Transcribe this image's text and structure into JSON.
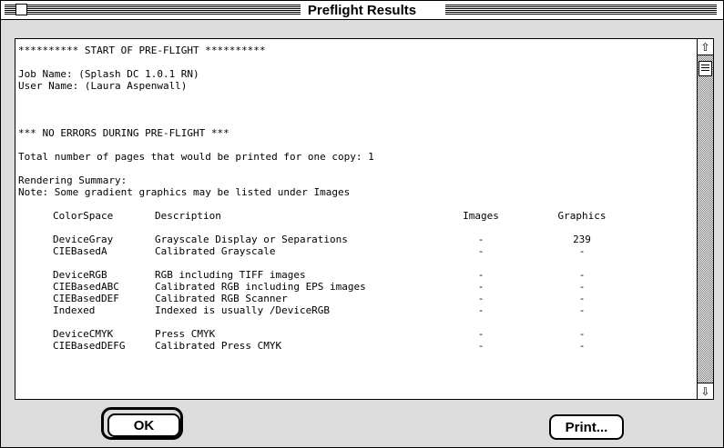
{
  "window": {
    "title": "Preflight Results"
  },
  "report": {
    "header": "********** START OF PRE-FLIGHT **********",
    "job_name": "Job Name: (Splash DC 1.0.1 RN)",
    "user_name": "User Name: (Laura Aspenwall)",
    "status": "*** NO ERRORS DURING PRE-FLIGHT ***",
    "pages": "Total number of pages that would be printed for one copy: 1",
    "summary_title": "Rendering Summary:",
    "summary_note": "Note: Some gradient graphics may be listed under Images",
    "columns": [
      "ColorSpace",
      "Description",
      "Images",
      "Graphics"
    ],
    "rows": [
      [
        "DeviceGray",
        "Grayscale Display or Separations",
        "-",
        "239"
      ],
      [
        "CIEBasedA",
        "Calibrated Grayscale",
        "-",
        "-"
      ],
      [
        "DeviceRGB",
        "RGB including TIFF images",
        "-",
        "-"
      ],
      [
        "CIEBasedABC",
        "Calibrated RGB including EPS images",
        "-",
        "-"
      ],
      [
        "CIEBasedDEF",
        "Calibrated RGB Scanner",
        "-",
        "-"
      ],
      [
        "Indexed",
        "Indexed is usually /DeviceRGB",
        "-",
        "-"
      ],
      [
        "DeviceCMYK",
        "Press CMYK",
        "-",
        "-"
      ],
      [
        "CIEBasedDEFG",
        "Calibrated Press CMYK",
        "-",
        "-"
      ]
    ]
  },
  "buttons": {
    "ok": "OK",
    "print": "Print..."
  },
  "icons": {
    "scroll_up": "up-arrow-icon",
    "scroll_down": "down-arrow-icon"
  }
}
